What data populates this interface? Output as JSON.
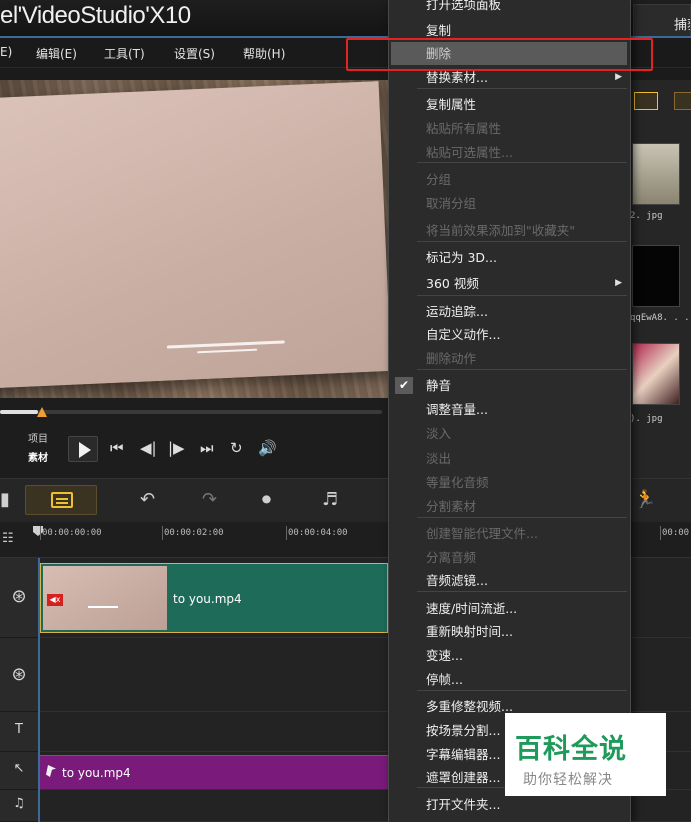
{
  "app": {
    "title": "el'VideoStudio'X10",
    "capture_tab": "捕获"
  },
  "menubar": [
    "E)",
    "编辑(E)",
    "工具(T)",
    "设置(S)",
    "帮助(H)"
  ],
  "player": {
    "mode_project": "项目",
    "mode_clip": "素材",
    "scrub_position_percent": 10
  },
  "ruler": {
    "ticks": [
      "00:00:00:00",
      "00:00:02:00",
      "00:00:04:00",
      "00:00:"
    ]
  },
  "timeline": {
    "video_clip_name": "to you.mp4",
    "audio_clip_name": "to you.mp4",
    "mute_badge": "◀x"
  },
  "library": {
    "items": [
      "2. jpg",
      "qqEwA8. . .",
      "). jpg"
    ]
  },
  "context_menu": {
    "items": [
      {
        "label": "打开选项面板",
        "state": "enabled"
      },
      {
        "label": "复制",
        "state": "enabled"
      },
      {
        "label": "删除",
        "state": "highlighted"
      },
      {
        "label": "替换素材...",
        "state": "enabled",
        "submenu": true
      },
      {
        "label": "复制属性",
        "state": "enabled"
      },
      {
        "label": "粘贴所有属性",
        "state": "disabled"
      },
      {
        "label": "粘贴可选属性...",
        "state": "disabled"
      },
      {
        "label": "分组",
        "state": "disabled"
      },
      {
        "label": "取消分组",
        "state": "disabled"
      },
      {
        "label": "将当前效果添加到\"收藏夹\"",
        "state": "disabled"
      },
      {
        "label": "标记为 3D...",
        "state": "enabled"
      },
      {
        "label": "360 视频",
        "state": "enabled",
        "submenu": true
      },
      {
        "label": "运动追踪...",
        "state": "enabled"
      },
      {
        "label": "自定义动作...",
        "state": "enabled"
      },
      {
        "label": "删除动作",
        "state": "disabled"
      },
      {
        "label": "静音",
        "state": "enabled",
        "checked": true
      },
      {
        "label": "调整音量...",
        "state": "enabled"
      },
      {
        "label": "淡入",
        "state": "disabled"
      },
      {
        "label": "淡出",
        "state": "disabled"
      },
      {
        "label": "等量化音频",
        "state": "disabled"
      },
      {
        "label": "分割素材",
        "state": "disabled"
      },
      {
        "label": "创建智能代理文件...",
        "state": "disabled"
      },
      {
        "label": "分离音频",
        "state": "disabled"
      },
      {
        "label": "音频滤镜...",
        "state": "enabled"
      },
      {
        "label": "速度/时间流逝...",
        "state": "enabled"
      },
      {
        "label": "重新映射时间...",
        "state": "enabled"
      },
      {
        "label": "变速...",
        "state": "enabled"
      },
      {
        "label": "停帧...",
        "state": "enabled"
      },
      {
        "label": "多重修整视频...",
        "state": "enabled"
      },
      {
        "label": "按场景分割...",
        "state": "enabled"
      },
      {
        "label": "字幕编辑器...",
        "state": "enabled"
      },
      {
        "label": "遮罩创建器...",
        "state": "enabled"
      },
      {
        "label": "打开文件夹...",
        "state": "enabled"
      }
    ]
  },
  "watermark": {
    "title": "百科全说",
    "subtitle": "助你轻松解决"
  },
  "colors": {
    "accent": "#3d6b99",
    "highlight_box": "#e52222",
    "video_clip": "#1e6b5a",
    "audio_clip": "#7a1a7a",
    "watermark_text": "#1e9a5a"
  }
}
